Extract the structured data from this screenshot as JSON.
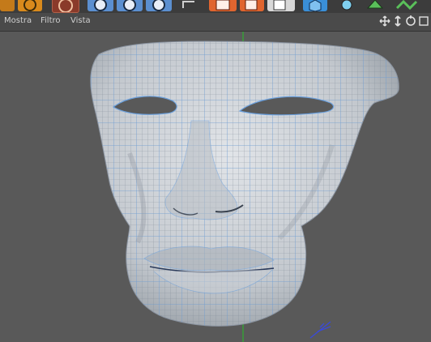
{
  "menu": {
    "items": [
      "Mostra",
      "Filtro",
      "Vista"
    ]
  },
  "toolbar": {
    "icons": [
      "undo-icon",
      "move-icon",
      "scale-icon",
      "rotate-icon",
      "cube-icon",
      "camera-icon",
      "render-icon",
      "render-settings-icon",
      "primitive-cube-icon",
      "spline-icon",
      "nurbs-icon",
      "deformer-icon"
    ]
  },
  "nav": {
    "icons": [
      "move-view-icon",
      "zoom-view-icon",
      "rotate-view-icon",
      "maximize-view-icon"
    ]
  },
  "colors": {
    "viewport_bg": "#595959",
    "menubar_bg": "#4a4a4a",
    "mesh_surface": "#c9cdd2",
    "mesh_wire": "#6a9fdc",
    "axis_green": "#2fae2f",
    "orange_button": "#e0652f",
    "blue_button": "#5b8fd0"
  }
}
